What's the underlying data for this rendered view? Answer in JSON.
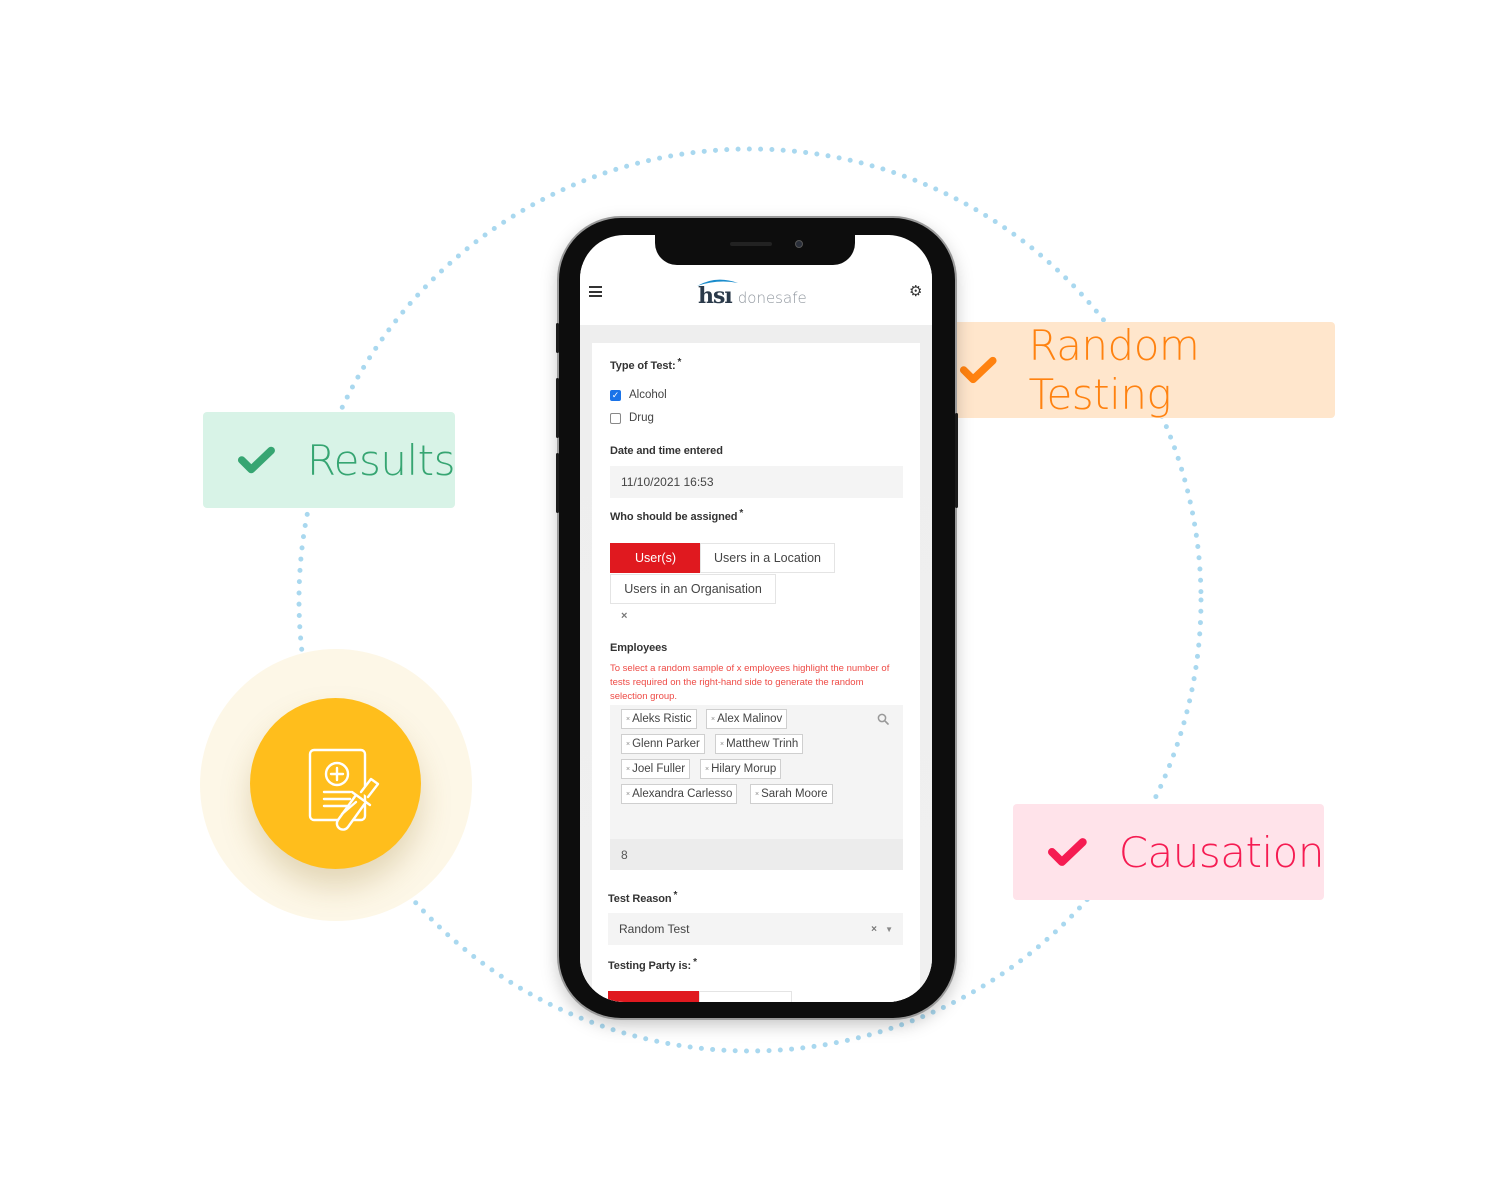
{
  "badges": {
    "results": {
      "label": "Results",
      "color": "#36a572",
      "bg": "#d8f3e7",
      "icon": "check-icon"
    },
    "random_testing": {
      "label": "Random Testing",
      "color": "#ff8210",
      "bg": "#ffe6cc",
      "icon": "check-icon"
    },
    "causation": {
      "label": "Causation",
      "color": "#f51c52",
      "bg": "#ffe3ea",
      "icon": "check-icon"
    }
  },
  "feature_icon": {
    "name": "medical-report-test-tube-icon",
    "color": "#ffbe1c"
  },
  "app": {
    "logo_mark": "hsı",
    "logo_text": "donesafe",
    "menu_icon": "hamburger-icon",
    "settings_icon": "gear-icon"
  },
  "form": {
    "type_of_test": {
      "label": "Type of Test:",
      "required": "*",
      "options": [
        {
          "label": "Alcohol",
          "checked": true
        },
        {
          "label": "Drug",
          "checked": false
        }
      ]
    },
    "date_time": {
      "label": "Date and time entered",
      "value": "11/10/2021 16:53"
    },
    "assigned": {
      "label": "Who should be assigned",
      "required": "*",
      "options": [
        {
          "label": "User(s)",
          "active": true
        },
        {
          "label": "Users in a Location",
          "active": false
        },
        {
          "label": "Users in an Organisation",
          "active": false
        }
      ],
      "clear": "×"
    },
    "employees": {
      "label": "Employees",
      "hint": "To select a random sample of x employees highlight the number of tests required on the right-hand side to generate the random selection group.",
      "tags": [
        "Aleks Ristic",
        "Alex Malinov",
        "Glenn Parker",
        "Matthew Trinh",
        "Joel Fuller",
        "Hilary Morup",
        "Alexandra Carlesso",
        "Sarah Moore"
      ],
      "remove_glyph": "×",
      "count": "8"
    },
    "test_reason": {
      "label": "Test Reason",
      "required": "*",
      "value": "Random Test",
      "clear": "×",
      "caret": "▼"
    },
    "testing_party": {
      "label": "Testing Party is:",
      "required": "*"
    }
  }
}
